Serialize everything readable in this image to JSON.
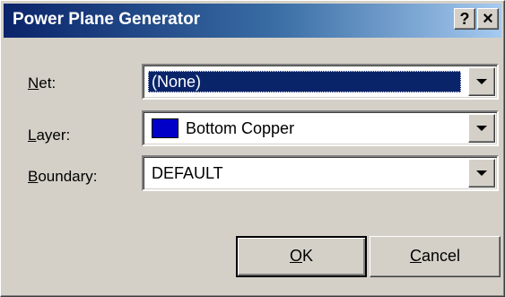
{
  "window": {
    "title": "Power Plane Generator",
    "help_button": "?",
    "close_button": "×"
  },
  "fields": {
    "net": {
      "label_hotkey": "N",
      "label_rest": "et:",
      "value": "(None)"
    },
    "layer": {
      "label_hotkey": "L",
      "label_rest": "ayer:",
      "value": "Bottom Copper",
      "swatch_color": "#0000c8"
    },
    "boundary": {
      "label_hotkey": "B",
      "label_rest": "oundary:",
      "value": "DEFAULT"
    }
  },
  "buttons": {
    "ok": {
      "hotkey": "O",
      "rest": "K"
    },
    "cancel": {
      "hotkey": "C",
      "rest": "ancel"
    }
  },
  "colors": {
    "titlebar_start": "#0a246a",
    "dialog_face": "#d4d0c8",
    "selection": "#0a246a"
  }
}
